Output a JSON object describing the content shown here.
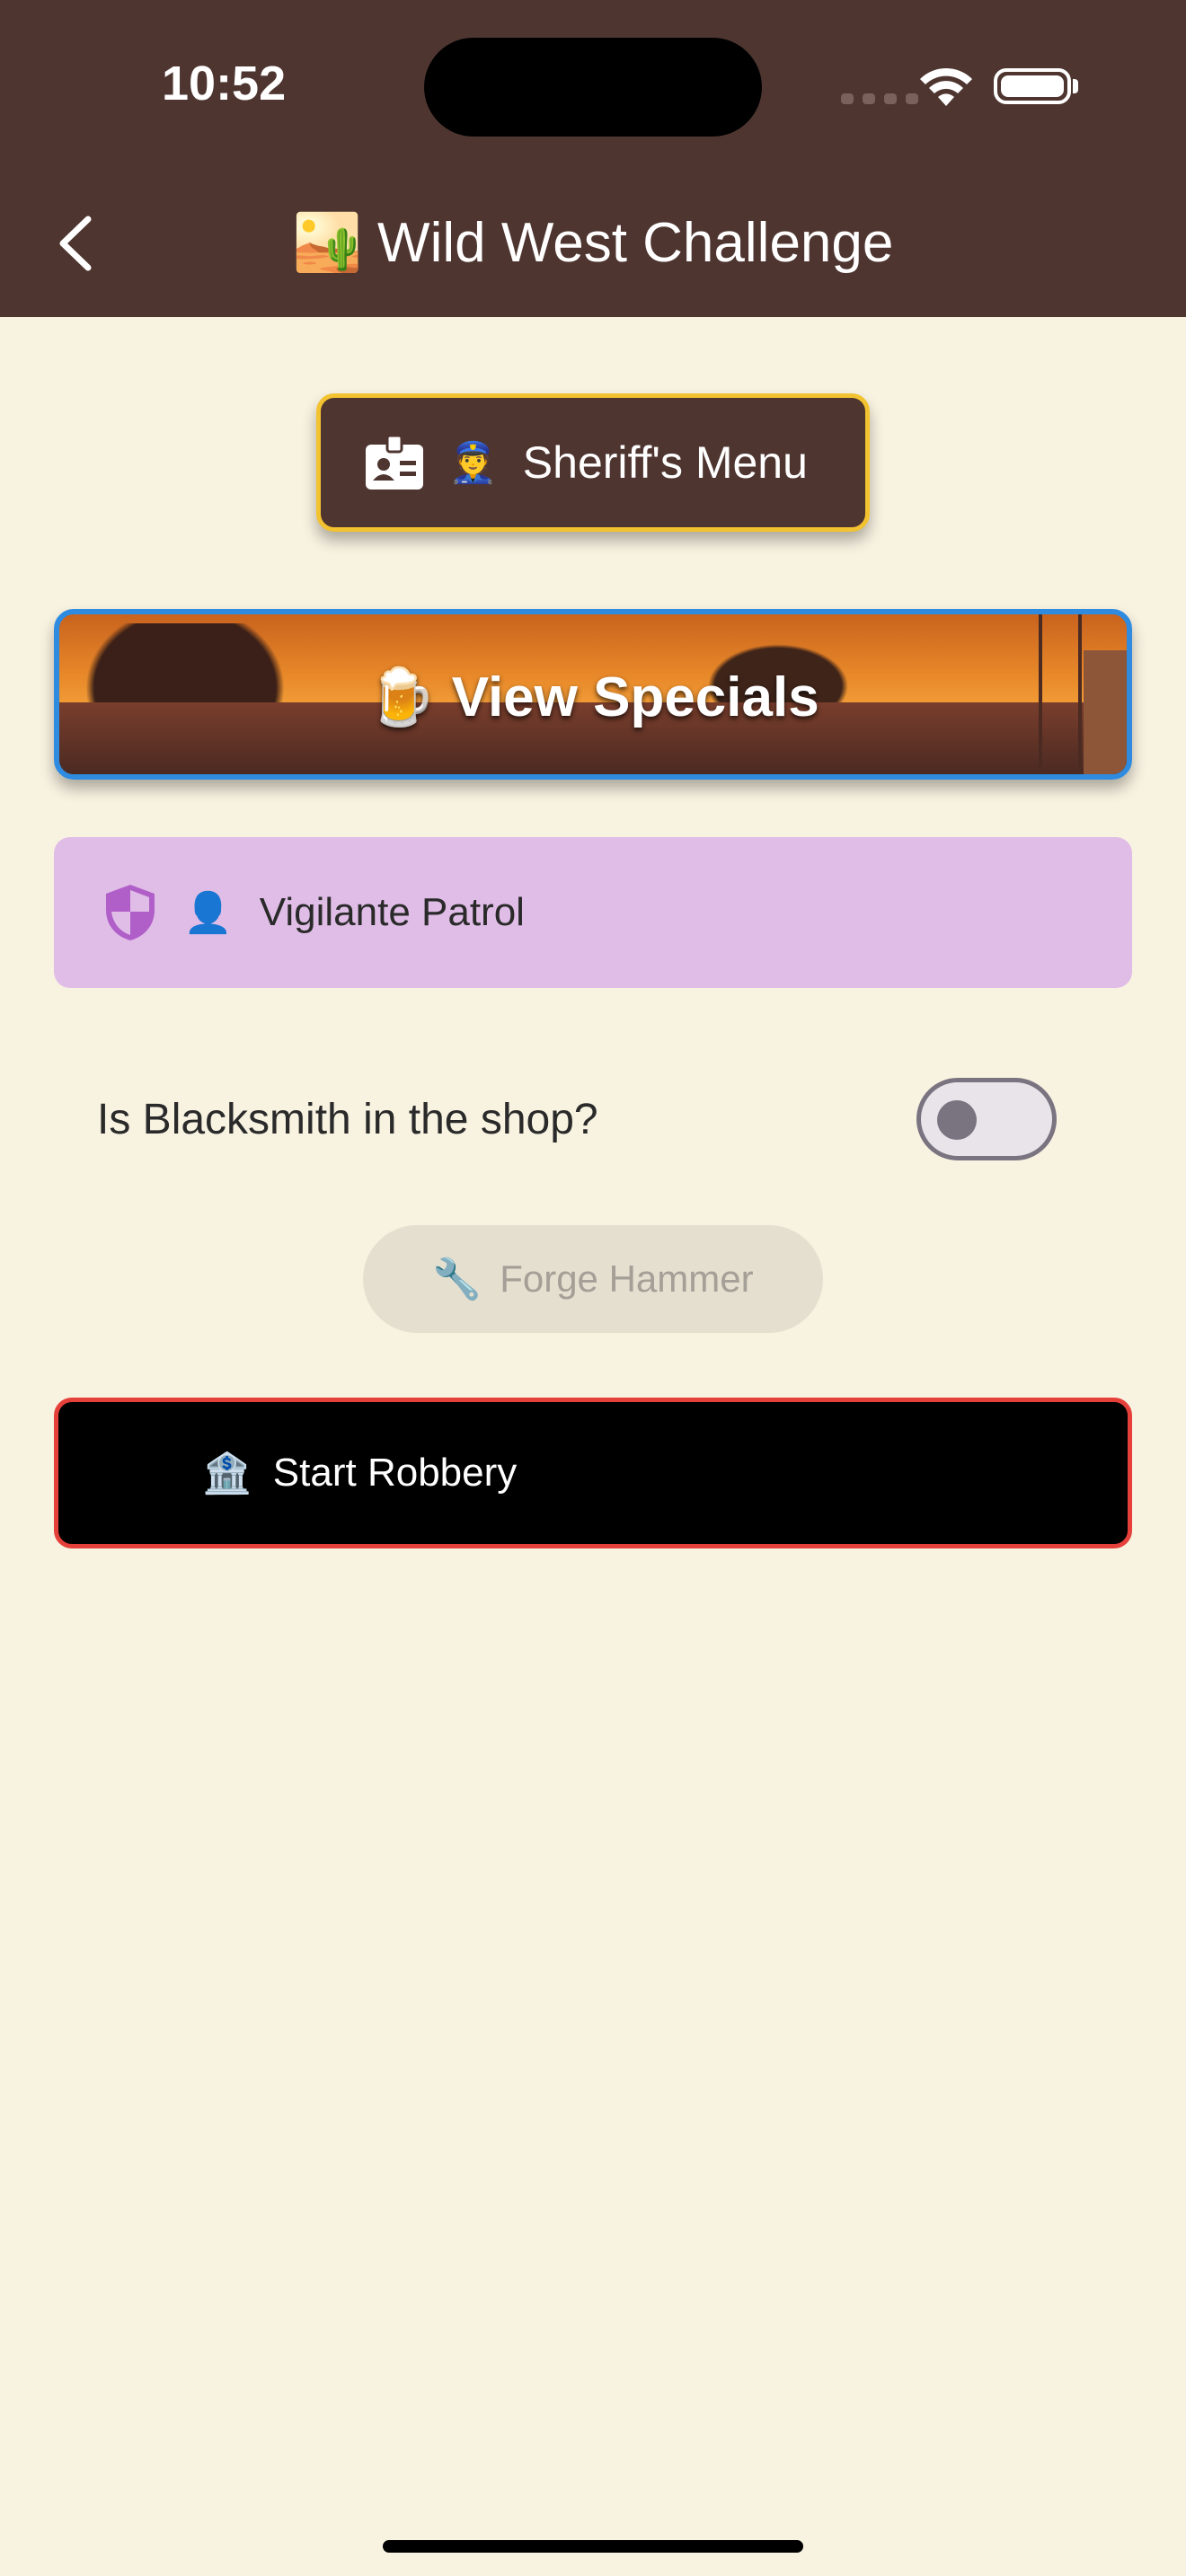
{
  "status": {
    "time": "10:52"
  },
  "nav": {
    "title": "🏜️ Wild West Challenge"
  },
  "sheriff_button": {
    "emoji": "👮",
    "label": "Sheriff's Menu"
  },
  "specials_button": {
    "label": "🍺 View Specials"
  },
  "patrol_button": {
    "emoji": "👤",
    "label": "Vigilante Patrol"
  },
  "toggle": {
    "label": "Is Blacksmith in the shop?",
    "value": false
  },
  "forge_button": {
    "emoji": "🔧",
    "label": "Forge Hammer",
    "enabled": false
  },
  "robbery_button": {
    "emoji": "🏦",
    "label": "Start Robbery"
  },
  "colors": {
    "header": "#4E3530",
    "background": "#F8F2E1",
    "sheriff_border": "#F2C230",
    "specials_border": "#2E8BE0",
    "patrol_bg": "#E0BDE7",
    "robbery_border": "#E5403A"
  }
}
